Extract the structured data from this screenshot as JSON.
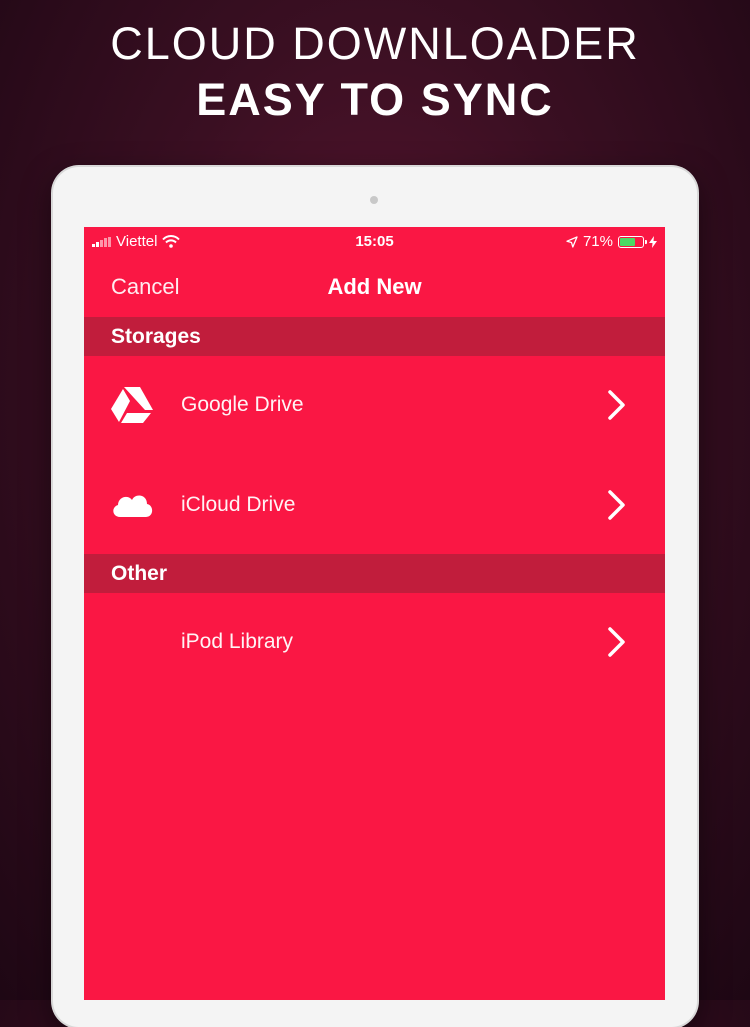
{
  "promo": {
    "line1": "CLOUD DOWNLOADER",
    "line2": "EASY TO SYNC"
  },
  "status_bar": {
    "carrier": "Viettel",
    "time": "15:05",
    "battery_percent": "71%",
    "battery_level": 0.71,
    "icons": [
      "signal-bars",
      "wifi",
      "location-arrow",
      "battery",
      "charging-bolt"
    ]
  },
  "nav": {
    "cancel_label": "Cancel",
    "title": "Add New"
  },
  "sections": {
    "storages": {
      "header": "Storages",
      "items": [
        {
          "label": "Google Drive",
          "icon": "google-drive-icon"
        },
        {
          "label": "iCloud Drive",
          "icon": "cloud-icon"
        }
      ]
    },
    "other": {
      "header": "Other",
      "items": [
        {
          "label": "iPod Library",
          "icon": ""
        }
      ]
    }
  },
  "colors": {
    "screen_bg": "#fa1744",
    "section_bg": "#c11d3c",
    "battery_fill": "#4cd964"
  }
}
